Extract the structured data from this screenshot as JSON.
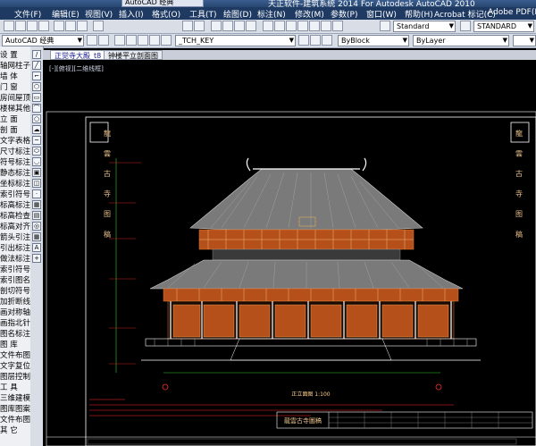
{
  "window": {
    "title": "天正软件-建筑系统 2014  For Autodesk AutoCAD 2010",
    "workspace": "AutoCAD 经典"
  },
  "menu": [
    "文件(F)",
    "编辑(E)",
    "视图(V)",
    "插入(I)",
    "格式(O)",
    "工具(T)",
    "绘图(D)",
    "标注(N)",
    "修改(M)",
    "参数(P)",
    "窗口(W)",
    "帮助(H)",
    "Acrobat 标记(C)",
    "Adobe PDF(B)"
  ],
  "toolbar": {
    "text_style": "Standard",
    "dim_style": "STANDARD",
    "workspace_select": "AutoCAD 经典",
    "layer": "_TCH_KEY",
    "color": "ByBlock",
    "linetype": "ByLayer"
  },
  "palette": {
    "items": [
      "设 置",
      "轴网柱子",
      "墙 体",
      "门 窗",
      "房间屋顶",
      "楼梯其他",
      "立 面",
      "剖 面",
      "文字表格",
      "尺寸标注",
      "符号标注",
      "静态标注",
      "坐标标注",
      "索引符号",
      "标高标注",
      "标高检查",
      "标高对齐",
      "箭头引注",
      "引出标注",
      "做法标注",
      "索引符号",
      "索引图名",
      "剖切符号",
      "加折断线",
      "画对称轴",
      "画指北针",
      "图名标注",
      "图 库",
      "文件布图",
      "文字复位",
      "图层控制",
      "工 具",
      "三维建模",
      "图库图案",
      "文件布图",
      "其 它"
    ]
  },
  "drawing_tabs": [
    "正觉寺大殿_t8",
    "钟楼平立剖面图"
  ],
  "viewport_label": "[-][俯视][二维线框]",
  "drawing": {
    "side_text": "龍 雲 古 寺 图 稿",
    "section_title": "正立面图  1:100",
    "title_block_name": "龍雲古寺圖稿"
  },
  "colors": {
    "title_bar": "#27466f",
    "menu_bar": "#1e3a63",
    "toolbar": "#d8dde6",
    "model_space": "#000000",
    "roof_tile": "#8a8a8a",
    "timber_orange": "#b5501a",
    "annotation_green": "#33cc33",
    "annotation_red": "#ff2a2a"
  },
  "icons": [
    "new-icon",
    "open-icon",
    "save-icon",
    "print-icon",
    "undo-icon",
    "redo-icon",
    "pan-icon",
    "zoom-icon",
    "properties-icon",
    "layer-icon",
    "line-icon",
    "circle-icon",
    "arc-icon",
    "text-icon"
  ]
}
